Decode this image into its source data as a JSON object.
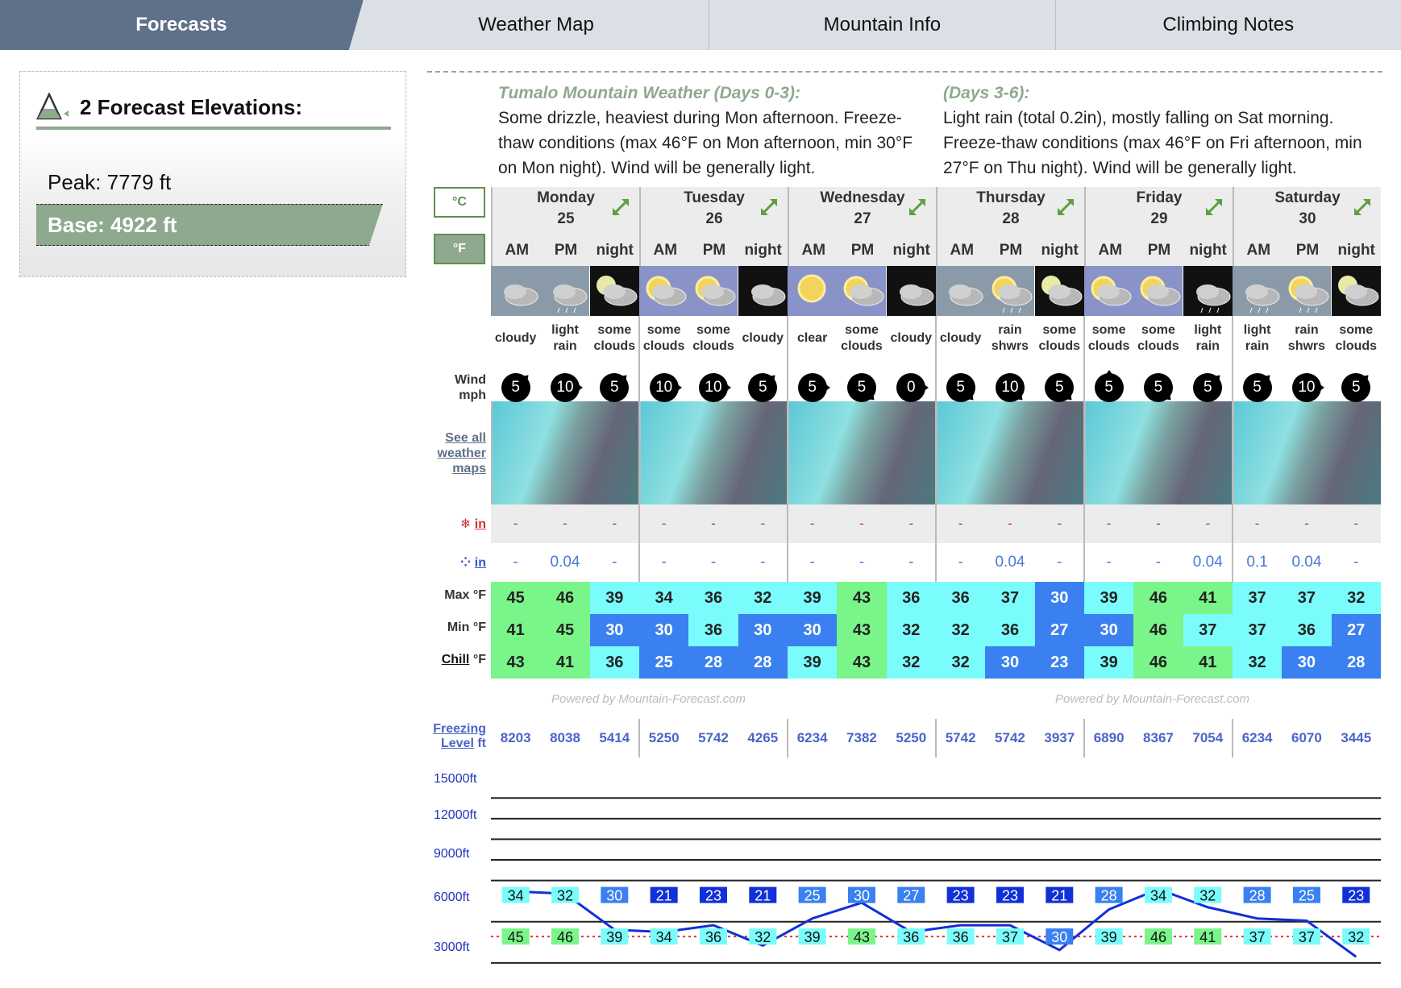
{
  "tabs": [
    {
      "label": "Forecasts",
      "active": true
    },
    {
      "label": "Weather Map"
    },
    {
      "label": "Mountain Info"
    },
    {
      "label": "Climbing Notes"
    }
  ],
  "elevations": {
    "title": "2 Forecast Elevations:",
    "peak": "Peak: 7779 ft",
    "base": "Base: 4922 ft",
    "icon": "mountain-elevation-icon"
  },
  "summary": {
    "part1": {
      "heading": "Tumalo Mountain Weather (Days 0-3):",
      "text": "Some drizzle, heaviest during Mon afternoon. Freeze-thaw conditions (max 46°F on Mon afternoon, min 30°F on Mon night). Wind will be generally light."
    },
    "part2": {
      "heading": "(Days 3-6):",
      "text": "Light rain (total 0.2in), mostly falling on Sat morning. Freeze-thaw conditions (max 46°F on Fri afternoon, min 27°F on Thu night). Wind will be generally light."
    }
  },
  "units": {
    "celsius": "°C",
    "fahrenheit": "°F",
    "active": "°F"
  },
  "labels": {
    "wind": "Wind",
    "wind_unit": "mph",
    "maps_link": "See all weather maps",
    "snow_unit": "in",
    "rain_unit": "in",
    "max": "Max °F",
    "min": "Min °F",
    "chill": "Chill",
    "chill_unit": " °F",
    "freezing": "Freezing",
    "level": "Level",
    "ft": " ft",
    "powered": "Powered by Mountain-Forecast.com"
  },
  "periods": [
    "AM",
    "PM",
    "night"
  ],
  "days": [
    {
      "name": "Monday",
      "date": "25"
    },
    {
      "name": "Tuesday",
      "date": "26"
    },
    {
      "name": "Wednesday",
      "date": "27"
    },
    {
      "name": "Thursday",
      "date": "28"
    },
    {
      "name": "Friday",
      "date": "29"
    },
    {
      "name": "Saturday",
      "date": "30"
    }
  ],
  "slots": [
    {
      "desc": "cloudy",
      "icon": "cloudy",
      "wind": "5",
      "dir": "ne",
      "snow": "-",
      "rain": "-",
      "max": "45",
      "min": "41",
      "chill": "43",
      "frz": "8203",
      "fl_temp": "34",
      "base_temp": "45"
    },
    {
      "desc": "light rain",
      "icon": "light-rain",
      "wind": "10",
      "dir": "e",
      "snow": "-",
      "rain": "0.04",
      "max": "46",
      "min": "45",
      "chill": "41",
      "frz": "8038",
      "fl_temp": "32",
      "base_temp": "46"
    },
    {
      "desc": "some clouds",
      "icon": "night-some-clouds",
      "wind": "5",
      "dir": "ne",
      "snow": "-",
      "rain": "-",
      "max": "39",
      "min": "30",
      "chill": "36",
      "frz": "5414",
      "fl_temp": "30",
      "base_temp": "39"
    },
    {
      "desc": "some clouds",
      "icon": "some-clouds",
      "wind": "10",
      "dir": "e",
      "snow": "-",
      "rain": "-",
      "max": "34",
      "min": "30",
      "chill": "25",
      "frz": "5250",
      "fl_temp": "21",
      "base_temp": "34"
    },
    {
      "desc": "some clouds",
      "icon": "some-clouds",
      "wind": "10",
      "dir": "e",
      "snow": "-",
      "rain": "-",
      "max": "36",
      "min": "36",
      "chill": "28",
      "frz": "5742",
      "fl_temp": "23",
      "base_temp": "36"
    },
    {
      "desc": "cloudy",
      "icon": "night-cloudy",
      "wind": "5",
      "dir": "ne",
      "snow": "-",
      "rain": "-",
      "max": "32",
      "min": "30",
      "chill": "28",
      "frz": "4265",
      "fl_temp": "21",
      "base_temp": "32"
    },
    {
      "desc": "clear",
      "icon": "clear",
      "wind": "5",
      "dir": "e",
      "snow": "-",
      "rain": "-",
      "max": "39",
      "min": "30",
      "chill": "39",
      "frz": "6234",
      "fl_temp": "25",
      "base_temp": "39"
    },
    {
      "desc": "some clouds",
      "icon": "some-clouds",
      "wind": "5",
      "dir": "se",
      "snow": "-",
      "rain": "-",
      "max": "43",
      "min": "43",
      "chill": "43",
      "frz": "7382",
      "fl_temp": "30",
      "base_temp": "43"
    },
    {
      "desc": "cloudy",
      "icon": "night-cloudy",
      "wind": "0",
      "dir": "e",
      "snow": "-",
      "rain": "-",
      "max": "36",
      "min": "32",
      "chill": "32",
      "frz": "5250",
      "fl_temp": "27",
      "base_temp": "36"
    },
    {
      "desc": "cloudy",
      "icon": "cloudy",
      "wind": "5",
      "dir": "se",
      "snow": "-",
      "rain": "-",
      "max": "36",
      "min": "32",
      "chill": "32",
      "frz": "5742",
      "fl_temp": "23",
      "base_temp": "36"
    },
    {
      "desc": "rain shwrs",
      "icon": "rain-showers",
      "wind": "10",
      "dir": "se",
      "snow": "-",
      "rain": "0.04",
      "max": "37",
      "min": "36",
      "chill": "30",
      "frz": "5742",
      "fl_temp": "23",
      "base_temp": "37"
    },
    {
      "desc": "some clouds",
      "icon": "night-some-clouds",
      "wind": "5",
      "dir": "se",
      "snow": "-",
      "rain": "-",
      "max": "30",
      "min": "27",
      "chill": "23",
      "frz": "3937",
      "fl_temp": "21",
      "base_temp": "30"
    },
    {
      "desc": "some clouds",
      "icon": "some-clouds",
      "wind": "5",
      "dir": "n",
      "snow": "-",
      "rain": "-",
      "max": "39",
      "min": "30",
      "chill": "39",
      "frz": "6890",
      "fl_temp": "28",
      "base_temp": "39"
    },
    {
      "desc": "some clouds",
      "icon": "some-clouds",
      "wind": "5",
      "dir": "se",
      "snow": "-",
      "rain": "-",
      "max": "46",
      "min": "46",
      "chill": "46",
      "frz": "8367",
      "fl_temp": "34",
      "base_temp": "46"
    },
    {
      "desc": "light rain",
      "icon": "night-light-rain",
      "wind": "5",
      "dir": "ne",
      "snow": "-",
      "rain": "0.04",
      "max": "41",
      "min": "37",
      "chill": "41",
      "frz": "7054",
      "fl_temp": "32",
      "base_temp": "41"
    },
    {
      "desc": "light rain",
      "icon": "light-rain",
      "wind": "5",
      "dir": "ne",
      "snow": "-",
      "rain": "0.1",
      "max": "37",
      "min": "37",
      "chill": "32",
      "frz": "6234",
      "fl_temp": "28",
      "base_temp": "37"
    },
    {
      "desc": "rain shwrs",
      "icon": "rain-showers",
      "wind": "10",
      "dir": "e",
      "snow": "-",
      "rain": "0.04",
      "max": "37",
      "min": "36",
      "chill": "30",
      "frz": "6070",
      "fl_temp": "25",
      "base_temp": "37"
    },
    {
      "desc": "some clouds",
      "icon": "night-some-clouds",
      "wind": "5",
      "dir": "ne",
      "snow": "-",
      "rain": "-",
      "max": "32",
      "min": "27",
      "chill": "28",
      "frz": "3445",
      "fl_temp": "23",
      "base_temp": "32"
    }
  ],
  "freezing_chart": {
    "y_ticks": [
      "15000ft",
      "12000ft",
      "9000ft",
      "6000ft",
      "3000ft"
    ],
    "range_ft": [
      0,
      17000
    ]
  },
  "colors": {
    "warm": "#7af58a",
    "cool": "#7afcfc",
    "cold": "#3a80f0",
    "deep": "#1030d8",
    "accent": "#8fa98f",
    "tab_active": "#5f7089"
  }
}
